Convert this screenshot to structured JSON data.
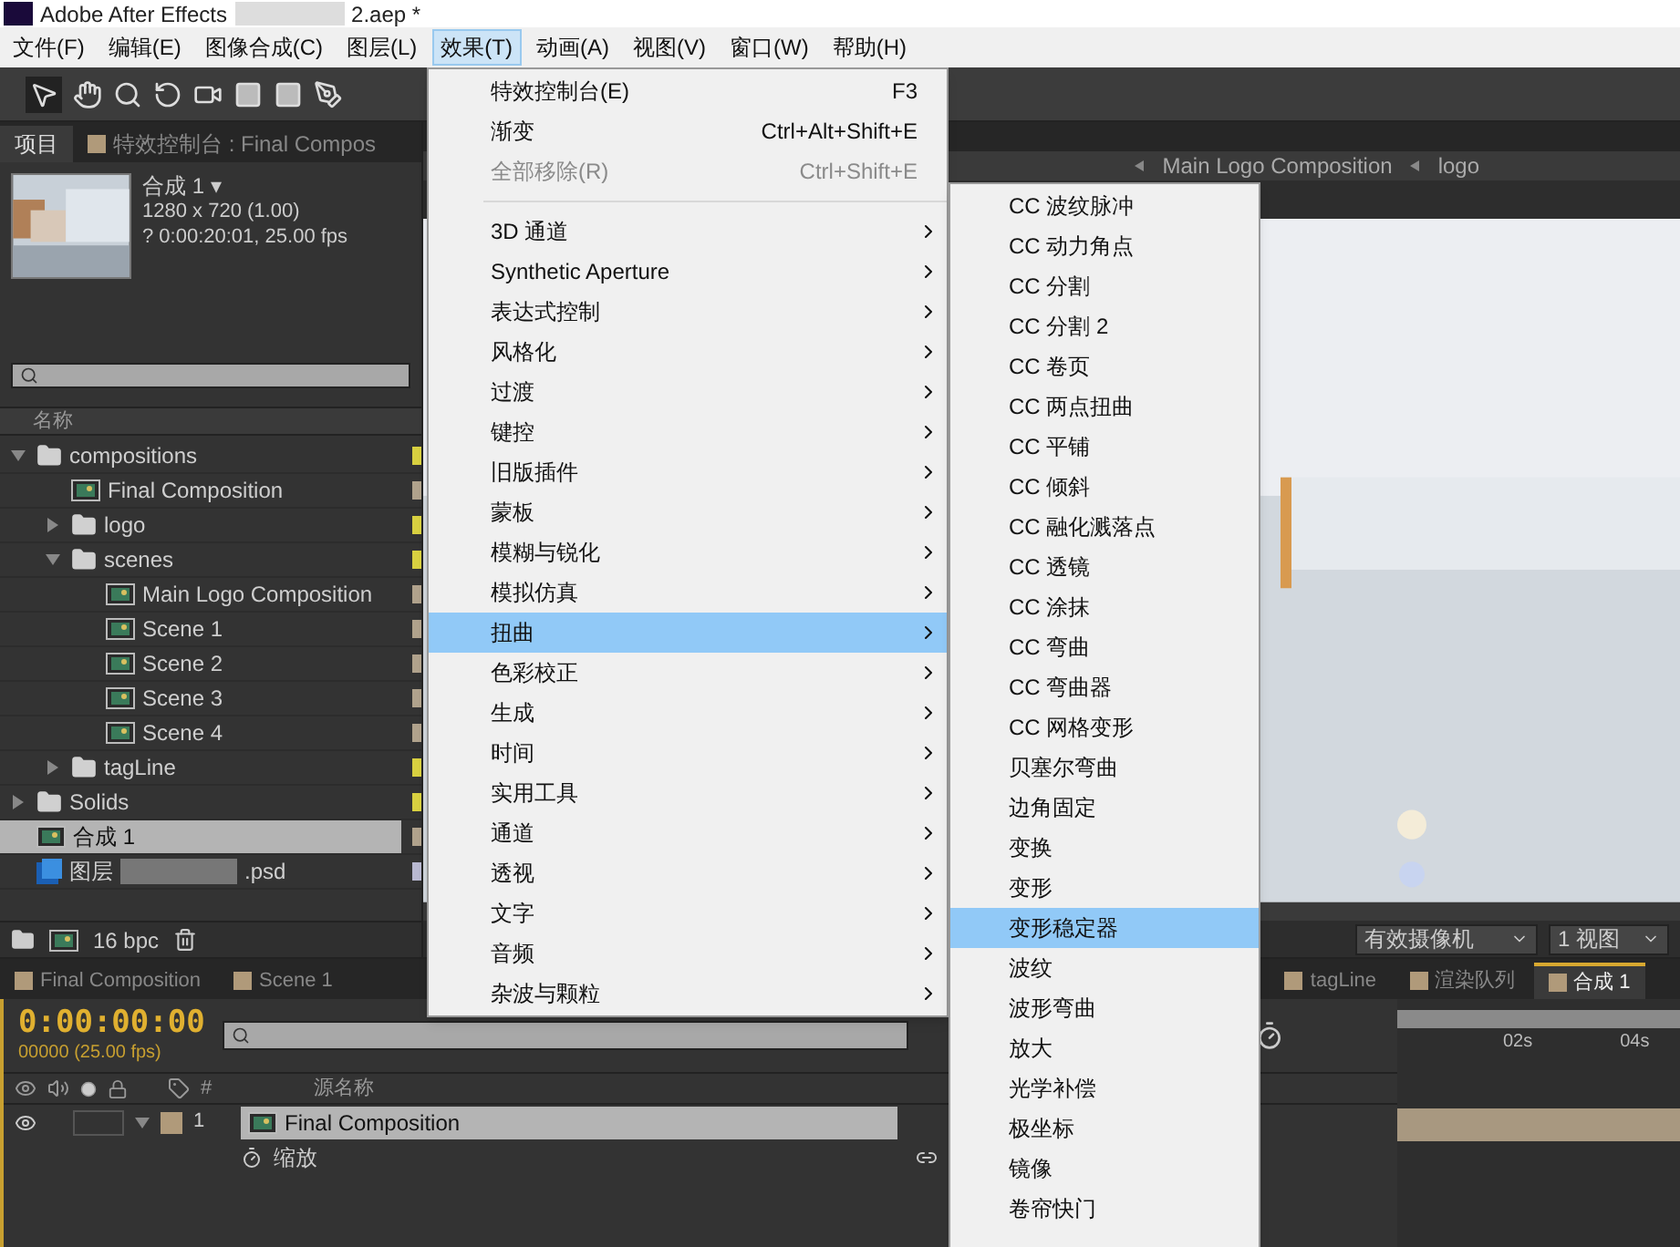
{
  "title_bar": {
    "app_title": "Adobe After Effects",
    "file_suffix": "2.aep *"
  },
  "menu_bar": [
    {
      "label": "文件(F)",
      "selected": false
    },
    {
      "label": "编辑(E)",
      "selected": false
    },
    {
      "label": "图像合成(C)",
      "selected": false
    },
    {
      "label": "图层(L)",
      "selected": false
    },
    {
      "label": "效果(T)",
      "selected": true
    },
    {
      "label": "动画(A)",
      "selected": false
    },
    {
      "label": "视图(V)",
      "selected": false
    },
    {
      "label": "窗口(W)",
      "selected": false
    },
    {
      "label": "帮助(H)",
      "selected": false
    }
  ],
  "project_panel": {
    "tabs": [
      {
        "label": "项目",
        "selected": true
      },
      {
        "label": "特效控制台 : Final Compos",
        "selected": false
      }
    ],
    "preview": {
      "name": "合成 1 ▾",
      "resolution": "1280 x 720 (1.00)",
      "duration": "? 0:00:20:01, 25.00 fps"
    },
    "column": "名称",
    "items": [
      {
        "kind": "folder",
        "label": "compositions",
        "expanded": true,
        "selected": false,
        "color": "#d8d040",
        "children": [
          {
            "kind": "comp",
            "label": "Final Composition",
            "selected": false,
            "color": "#b0a28c"
          },
          {
            "kind": "folder",
            "label": "logo",
            "expanded": false,
            "selected": false,
            "color": "#d8d040"
          },
          {
            "kind": "folder",
            "label": "scenes",
            "expanded": true,
            "selected": false,
            "color": "#d8d040",
            "children": [
              {
                "kind": "comp",
                "label": "Main Logo Composition",
                "selected": false,
                "color": "#b0a28c"
              },
              {
                "kind": "comp",
                "label": "Scene 1",
                "selected": false,
                "color": "#b0a28c"
              },
              {
                "kind": "comp",
                "label": "Scene 2",
                "selected": false,
                "color": "#b0a28c"
              },
              {
                "kind": "comp",
                "label": "Scene 3",
                "selected": false,
                "color": "#b0a28c"
              },
              {
                "kind": "comp",
                "label": "Scene 4",
                "selected": false,
                "color": "#b0a28c"
              }
            ]
          },
          {
            "kind": "folder",
            "label": "tagLine",
            "expanded": false,
            "selected": false,
            "color": "#d8d040"
          }
        ]
      },
      {
        "kind": "folder",
        "label": "Solids",
        "expanded": false,
        "selected": false,
        "color": "#d8d040"
      },
      {
        "kind": "comp",
        "label": "合成 1",
        "selected": true,
        "color": "#b0a28c"
      },
      {
        "kind": "psd",
        "label": "图层",
        "label_end": ".psd",
        "selected": false,
        "color": "#b8b8d0"
      }
    ],
    "bpc": "16 bpc"
  },
  "viewer": {
    "breadcrumbs": [
      "Main Logo Composition",
      "logo"
    ],
    "camera": "有效摄像机",
    "views": "1 视图"
  },
  "timeline": {
    "tabs": [
      {
        "label": "Final Composition",
        "selected": false
      },
      {
        "label": "Scene 1",
        "selected": false
      },
      {
        "label": "tagLine",
        "selected": false
      },
      {
        "label": "渲染队列",
        "selected": false
      },
      {
        "label": "合成 1",
        "selected": true
      }
    ],
    "timecode": "0:00:00:00",
    "frame_info": "00000 (25.00 fps)",
    "columns": [
      "#",
      "源名称"
    ],
    "layers": [
      {
        "number": "1",
        "name": "Final Composition",
        "selected": true
      }
    ],
    "property": "缩放",
    "ruler": [
      "02s",
      "04s"
    ]
  },
  "effect_menu": [
    {
      "kind": "command",
      "label": "特效控制台(E)",
      "shortcut": "F3",
      "disabled": false
    },
    {
      "kind": "command",
      "label": "渐变",
      "shortcut": "Ctrl+Alt+Shift+E",
      "disabled": false
    },
    {
      "kind": "command",
      "label": "全部移除(R)",
      "shortcut": "Ctrl+Shift+E",
      "disabled": true
    },
    {
      "kind": "separator"
    },
    {
      "kind": "submenu",
      "label": "3D 通道",
      "selected": false
    },
    {
      "kind": "submenu",
      "label": "Synthetic Aperture",
      "selected": false
    },
    {
      "kind": "submenu",
      "label": "表达式控制",
      "selected": false
    },
    {
      "kind": "submenu",
      "label": "风格化",
      "selected": false
    },
    {
      "kind": "submenu",
      "label": "过渡",
      "selected": false
    },
    {
      "kind": "submenu",
      "label": "键控",
      "selected": false
    },
    {
      "kind": "submenu",
      "label": "旧版插件",
      "selected": false
    },
    {
      "kind": "submenu",
      "label": "蒙板",
      "selected": false
    },
    {
      "kind": "submenu",
      "label": "模糊与锐化",
      "selected": false
    },
    {
      "kind": "submenu",
      "label": "模拟仿真",
      "selected": false
    },
    {
      "kind": "submenu",
      "label": "扭曲",
      "selected": true
    },
    {
      "kind": "submenu",
      "label": "色彩校正",
      "selected": false
    },
    {
      "kind": "submenu",
      "label": "生成",
      "selected": false
    },
    {
      "kind": "submenu",
      "label": "时间",
      "selected": false
    },
    {
      "kind": "submenu",
      "label": "实用工具",
      "selected": false
    },
    {
      "kind": "submenu",
      "label": "通道",
      "selected": false
    },
    {
      "kind": "submenu",
      "label": "透视",
      "selected": false
    },
    {
      "kind": "submenu",
      "label": "文字",
      "selected": false
    },
    {
      "kind": "submenu",
      "label": "音频",
      "selected": false
    },
    {
      "kind": "submenu",
      "label": "杂波与颗粒",
      "selected": false
    }
  ],
  "distort_submenu": [
    {
      "label": "CC 波纹脉冲",
      "selected": false
    },
    {
      "label": "CC 动力角点",
      "selected": false
    },
    {
      "label": "CC 分割",
      "selected": false
    },
    {
      "label": "CC 分割 2",
      "selected": false
    },
    {
      "label": "CC 卷页",
      "selected": false
    },
    {
      "label": "CC 两点扭曲",
      "selected": false
    },
    {
      "label": "CC 平铺",
      "selected": false
    },
    {
      "label": "CC 倾斜",
      "selected": false
    },
    {
      "label": "CC 融化溅落点",
      "selected": false
    },
    {
      "label": "CC 透镜",
      "selected": false
    },
    {
      "label": "CC 涂抹",
      "selected": false
    },
    {
      "label": "CC 弯曲",
      "selected": false
    },
    {
      "label": "CC 弯曲器",
      "selected": false
    },
    {
      "label": "CC 网格变形",
      "selected": false
    },
    {
      "label": "贝塞尔弯曲",
      "selected": false
    },
    {
      "label": "边角固定",
      "selected": false
    },
    {
      "label": "变换",
      "selected": false
    },
    {
      "label": "变形",
      "selected": false
    },
    {
      "label": "变形稳定器",
      "selected": true
    },
    {
      "label": "波纹",
      "selected": false
    },
    {
      "label": "波形弯曲",
      "selected": false
    },
    {
      "label": "放大",
      "selected": false
    },
    {
      "label": "光学补偿",
      "selected": false
    },
    {
      "label": "极坐标",
      "selected": false
    },
    {
      "label": "镜像",
      "selected": false
    },
    {
      "label": "卷帘快门",
      "selected": false
    }
  ]
}
